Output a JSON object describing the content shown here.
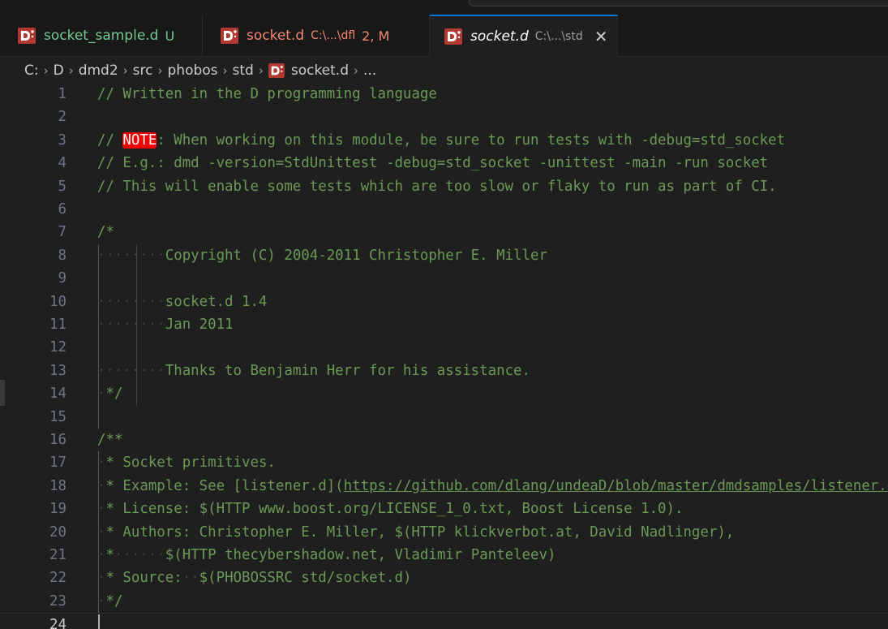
{
  "colors": {
    "tab_active_bg": "#1f1f1f",
    "tab_bar_bg": "#181818",
    "accent": "#0078d4",
    "comment": "#6a9955",
    "untracked": "#73c991",
    "modified": "#f48771",
    "note_bg": "#f00000",
    "d_icon": "#b03931"
  },
  "tabs": [
    {
      "title": "socket_sample.d",
      "path": "",
      "status": "U",
      "title_color": "#73c991",
      "status_color": "#73c991",
      "italic": false,
      "active": false,
      "icon": "d-language-icon"
    },
    {
      "title": "socket.d",
      "path": "C:\\...\\dfl",
      "status": "2, M",
      "title_color": "#f48771",
      "status_color": "#f48771",
      "italic": false,
      "active": false,
      "icon": "d-language-icon"
    },
    {
      "title": "socket.d",
      "path": "C:\\...\\std",
      "status": "",
      "close_glyph": "✕",
      "title_color": "#ffffff",
      "status_color": "#cccccc",
      "italic": true,
      "active": true,
      "icon": "d-language-icon"
    }
  ],
  "breadcrumb": [
    "C:",
    "D",
    "dmd2",
    "src",
    "phobos",
    "std",
    "socket.d",
    "..."
  ],
  "lines": [
    {
      "n": "1",
      "segs": [
        {
          "t": "// Written in the D programming language"
        }
      ]
    },
    {
      "n": "2",
      "segs": []
    },
    {
      "n": "3",
      "segs": [
        {
          "t": "// "
        },
        {
          "t": "NOTE",
          "k": "note"
        },
        {
          "t": ": When working on this module, be sure to run tests with -debug=std_socket"
        }
      ]
    },
    {
      "n": "4",
      "segs": [
        {
          "t": "// E.g.: dmd -version=StdUnittest -debug=std_socket -unittest -main -run socket"
        }
      ]
    },
    {
      "n": "5",
      "segs": [
        {
          "t": "// This will enable some tests which are too slow or flaky to run as part of CI."
        }
      ]
    },
    {
      "n": "6",
      "segs": []
    },
    {
      "n": "7",
      "segs": [
        {
          "t": "/*"
        }
      ]
    },
    {
      "n": "8",
      "segs": [
        {
          "t": "········",
          "k": "ws"
        },
        {
          "t": "Copyright (C) 2004-2011 Christopher E. Miller"
        }
      ]
    },
    {
      "n": "9",
      "segs": []
    },
    {
      "n": "10",
      "segs": [
        {
          "t": "········",
          "k": "ws"
        },
        {
          "t": "socket.d 1.4"
        }
      ]
    },
    {
      "n": "11",
      "segs": [
        {
          "t": "········",
          "k": "ws"
        },
        {
          "t": "Jan 2011"
        }
      ]
    },
    {
      "n": "12",
      "segs": []
    },
    {
      "n": "13",
      "segs": [
        {
          "t": "········",
          "k": "ws"
        },
        {
          "t": "Thanks to Benjamin Herr for his assistance."
        }
      ]
    },
    {
      "n": "14",
      "segs": [
        {
          "t": "·",
          "k": "ws"
        },
        {
          "t": "*/"
        }
      ]
    },
    {
      "n": "15",
      "segs": []
    },
    {
      "n": "16",
      "segs": [
        {
          "t": "/**"
        }
      ]
    },
    {
      "n": "17",
      "segs": [
        {
          "t": "·",
          "k": "ws"
        },
        {
          "t": "* Socket primitives."
        }
      ]
    },
    {
      "n": "18",
      "segs": [
        {
          "t": "·",
          "k": "ws"
        },
        {
          "t": "* Example: See [listener.d]("
        },
        {
          "t": "https://github.com/dlang/undeaD/blob/master/dmdsamples/listener.d",
          "k": "link"
        }
      ]
    },
    {
      "n": "19",
      "segs": [
        {
          "t": "·",
          "k": "ws"
        },
        {
          "t": "* License: $(HTTP www.boost.org/LICENSE_1_0.txt, Boost License 1.0)."
        }
      ]
    },
    {
      "n": "20",
      "segs": [
        {
          "t": "·",
          "k": "ws"
        },
        {
          "t": "* Authors: Christopher E. Miller, $(HTTP klickverbot.at, David Nadlinger),"
        }
      ]
    },
    {
      "n": "21",
      "segs": [
        {
          "t": "·",
          "k": "ws"
        },
        {
          "t": "*"
        },
        {
          "t": "······",
          "k": "ws"
        },
        {
          "t": "$(HTTP thecybershadow.net, Vladimir Panteleev)"
        }
      ]
    },
    {
      "n": "22",
      "segs": [
        {
          "t": "·",
          "k": "ws"
        },
        {
          "t": "* Source:"
        },
        {
          "t": "··",
          "k": "ws"
        },
        {
          "t": "$(PHOBOSSRC std/socket.d)"
        }
      ]
    },
    {
      "n": "23",
      "segs": [
        {
          "t": "·",
          "k": "ws"
        },
        {
          "t": "*/"
        }
      ]
    },
    {
      "n": "24",
      "segs": [],
      "current": true
    }
  ]
}
